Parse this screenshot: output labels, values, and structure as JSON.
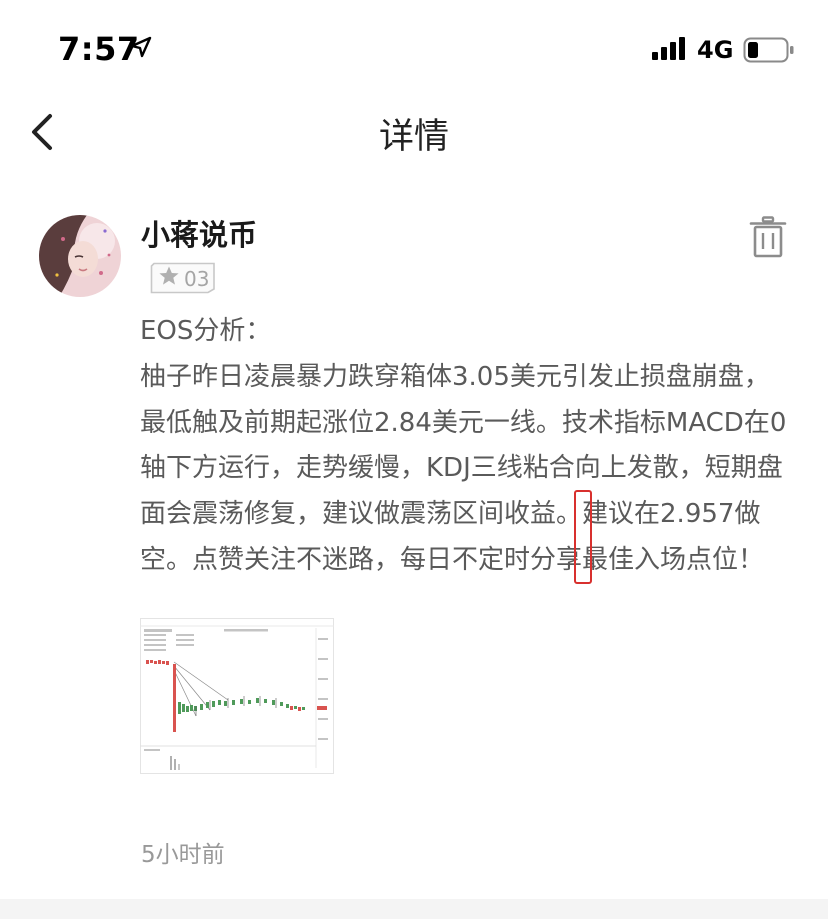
{
  "status_bar": {
    "time": "7:57",
    "network": "4G",
    "location_icon": "location-arrow-icon",
    "signal_icon": "cellular-signal-icon",
    "battery_icon": "battery-low-icon"
  },
  "nav": {
    "title": "详情",
    "back_icon": "chevron-left-icon"
  },
  "post": {
    "author": "小蒋说币",
    "level": "03",
    "title_line": "EOS分析：",
    "body_part1": "柚子昨日凌晨暴力跌穿箱体3.05美元引发止损盘崩盘，最低触及前期起涨位2.84美元一线。技术指标MACD在0轴下方运行，走势缓慢，KDJ三线粘合向上发散，短期盘面会震荡修复，建议做震荡区间收益。",
    "body_highlight": "建议在2.957做空。",
    "body_part2": "点赞关注不迷路，每日不定时分享最佳入场点位！",
    "timestamp": "5小时前"
  },
  "colors": {
    "highlight_border": "#d8302e",
    "body_text": "#5a5a5a",
    "secondary_text": "#999999",
    "chart_candle_red": "#d9534f",
    "chart_candle_green": "#4f9a5a"
  }
}
